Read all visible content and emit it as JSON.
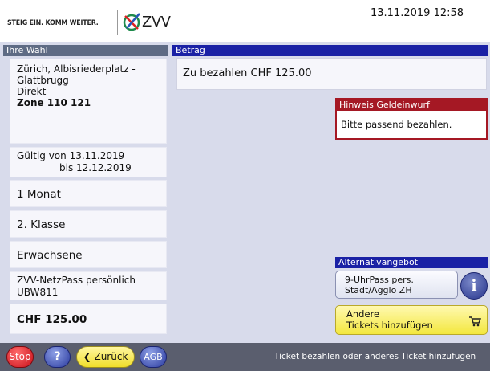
{
  "header": {
    "slogan": "STEIG EIN. KOMM WEITER.",
    "logo_text": "ZVV",
    "datetime": "13.11.2019  12:58"
  },
  "left_panel": {
    "title": "Ihre Wahl",
    "route": {
      "line1": "Zürich, Albisriederplatz -",
      "line2": "Glattbrugg",
      "line3": "Direkt",
      "zone": "Zone 110 121"
    },
    "validity": {
      "from": "Gültig von 13.11.2019",
      "to": "bis 12.12.2019"
    },
    "duration": "1 Monat",
    "class": "2. Klasse",
    "passenger": "Erwachsene",
    "ticket": {
      "line1": "ZVV-NetzPass persönlich",
      "line2": "UBW811"
    },
    "price": "CHF  125.00"
  },
  "betrag": {
    "title": "Betrag",
    "amount_text": "Zu bezahlen  CHF  125.00"
  },
  "hinweis": {
    "title": "Hinweis Geldeinwurf",
    "text": "Bitte passend bezahlen."
  },
  "alternatives": {
    "title": "Alternativangebot",
    "option_line1": "9-UhrPass pers.",
    "option_line2": "Stadt/Agglo ZH",
    "info_label": "i"
  },
  "add_tickets": {
    "line1": "Andere",
    "line2": "Tickets hinzufügen"
  },
  "footer": {
    "stop": "Stop",
    "help": "?",
    "back": "Zurück",
    "agb": "AGB",
    "message": "Ticket bezahlen oder anderes Ticket hinzufügen"
  },
  "colors": {
    "brand_blue": "#1a21a5",
    "warning_red": "#a51824",
    "accent_yellow": "#f3e73e",
    "panel_bg": "#d8dbeb"
  }
}
